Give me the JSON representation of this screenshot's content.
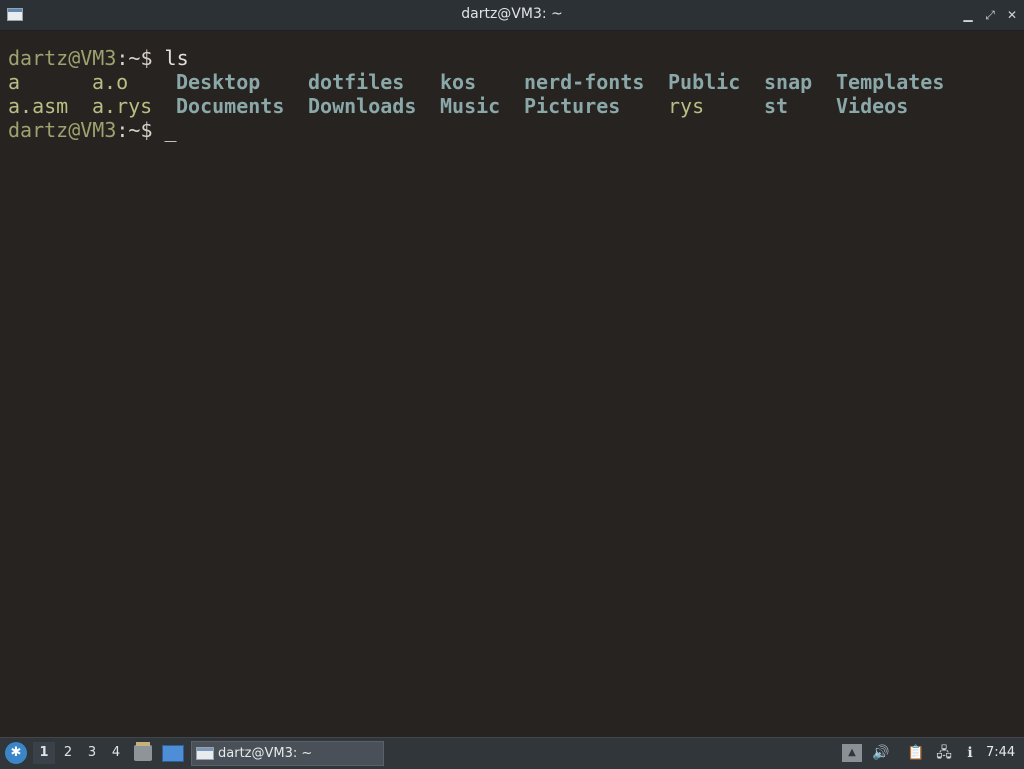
{
  "window": {
    "title": "dartz@VM3: ~"
  },
  "terminal": {
    "prompt_user": "dartz@VM3",
    "prompt_path": ":~$ ",
    "command": "ls",
    "cursor": "_",
    "ls_output": [
      [
        "a",
        "a.o",
        "Desktop",
        "dotfiles",
        "kos",
        "nerd-fonts",
        "Public",
        "snap",
        "Templates"
      ],
      [
        "a.asm",
        "a.rys",
        "Documents",
        "Downloads",
        "Music",
        "Pictures",
        "rys",
        "st",
        "Videos"
      ]
    ],
    "ls_types": [
      [
        "file",
        "file",
        "dir",
        "dir",
        "dir",
        "dir",
        "dir",
        "dir",
        "dir"
      ],
      [
        "file",
        "file",
        "dir",
        "dir",
        "dir",
        "dir",
        "file",
        "dir",
        "dir"
      ]
    ]
  },
  "taskbar": {
    "workspaces": [
      "1",
      "2",
      "3",
      "4"
    ],
    "active_workspace": "1",
    "task_label": "dartz@VM3: ~",
    "clock": "7:44"
  },
  "colors": {
    "background": "#262321",
    "prompt_user": "#9ea26e",
    "directory": "#8ba8a9",
    "file": "#b9bf84"
  }
}
